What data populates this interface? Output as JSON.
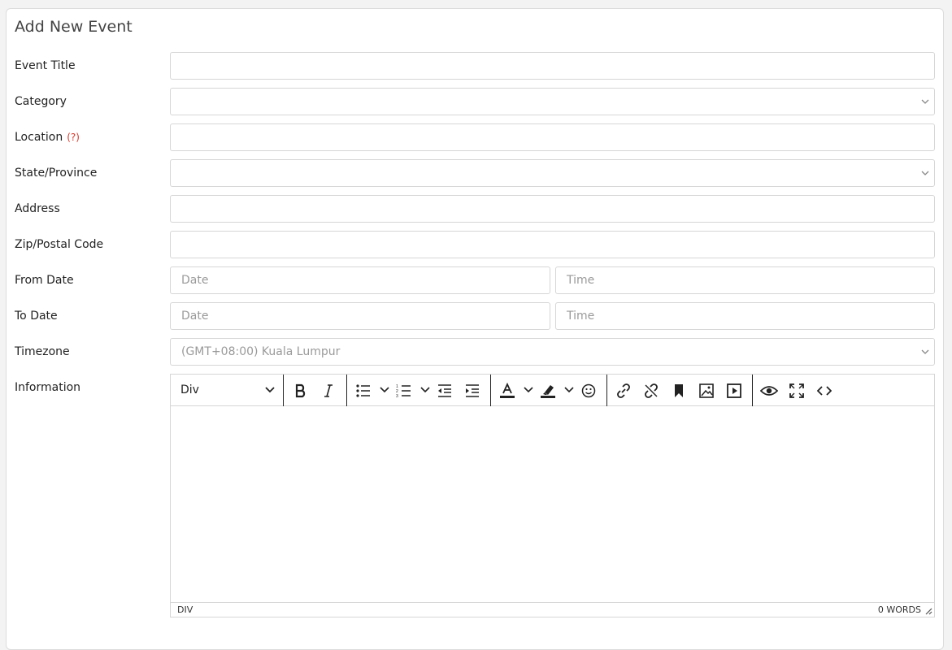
{
  "form": {
    "title": "Add New Event",
    "fields": {
      "event_title": {
        "label": "Event Title",
        "value": ""
      },
      "category": {
        "label": "Category",
        "value": ""
      },
      "location": {
        "label": "Location",
        "help": "(?)",
        "value": ""
      },
      "state": {
        "label": "State/Province",
        "value": ""
      },
      "address": {
        "label": "Address",
        "value": ""
      },
      "zip": {
        "label": "Zip/Postal Code",
        "value": ""
      },
      "from_date": {
        "label": "From Date",
        "date_placeholder": "Date",
        "time_placeholder": "Time"
      },
      "to_date": {
        "label": "To Date",
        "date_placeholder": "Date",
        "time_placeholder": "Time"
      },
      "timezone": {
        "label": "Timezone",
        "value": "(GMT+08:00) Kuala Lumpur"
      },
      "information": {
        "label": "Information"
      }
    }
  },
  "editor": {
    "block_format": "Div",
    "status_path": "DIV",
    "word_count": "0 WORDS",
    "toolbar_icons": [
      "bold-icon",
      "italic-icon",
      "bullet-list-icon",
      "numbered-list-icon",
      "outdent-icon",
      "indent-icon",
      "text-color-icon",
      "highlight-icon",
      "emoji-icon",
      "link-icon",
      "unlink-icon",
      "bookmark-icon",
      "image-icon",
      "media-icon",
      "preview-icon",
      "fullscreen-icon",
      "source-code-icon"
    ]
  }
}
